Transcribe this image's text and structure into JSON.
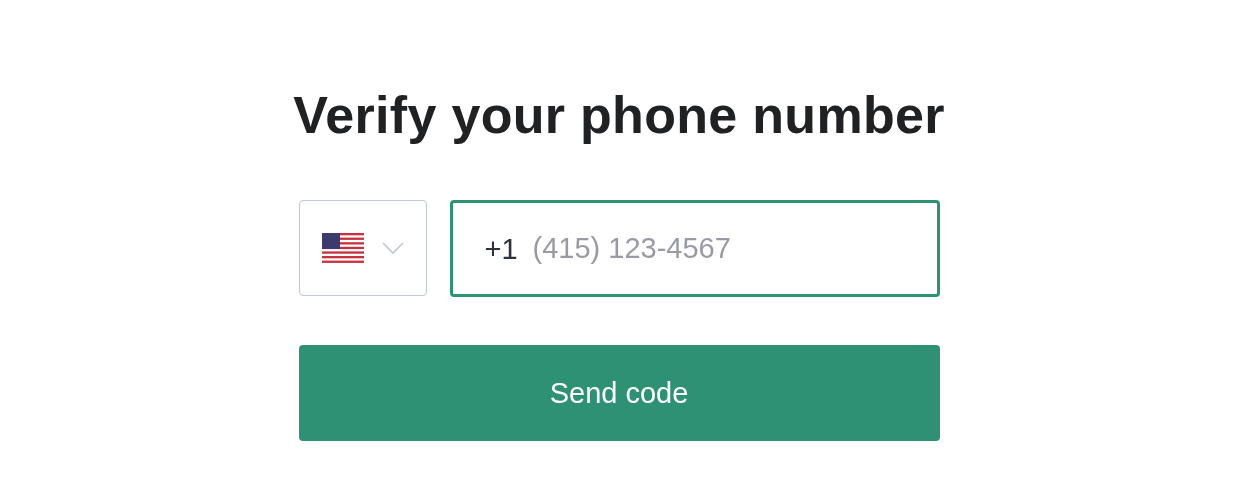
{
  "title": "Verify your phone number",
  "phone": {
    "country_code": "+1",
    "placeholder": "(415) 123-4567",
    "focused": true
  },
  "submit": {
    "label": "Send code"
  }
}
